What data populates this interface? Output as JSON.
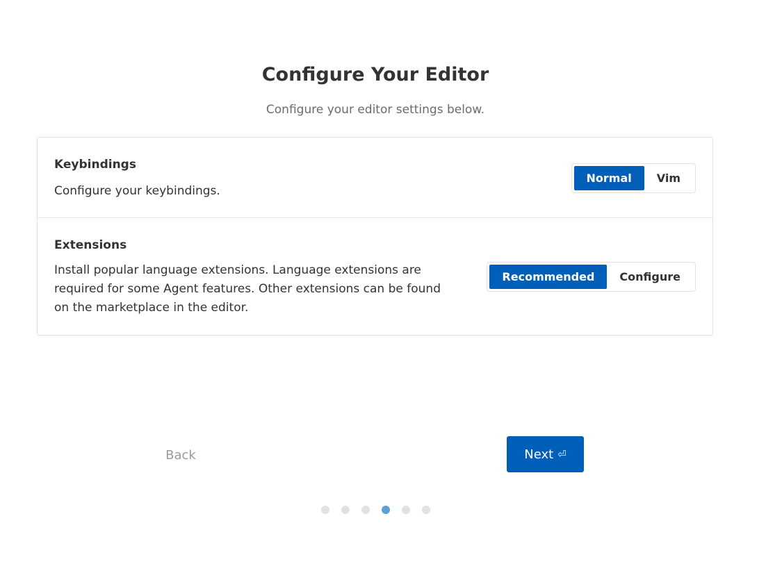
{
  "header": {
    "title": "Configure Your Editor",
    "subtitle": "Configure your editor settings below."
  },
  "settings": {
    "keybindings": {
      "title": "Keybindings",
      "description": "Configure your keybindings.",
      "options": [
        "Normal",
        "Vim"
      ],
      "selected": "Normal"
    },
    "extensions": {
      "title": "Extensions",
      "description": "Install popular language extensions. Language extensions are required for some Agent features. Other extensions can be found on the marketplace in the editor.",
      "options": [
        "Recommended",
        "Configure"
      ],
      "selected": "Recommended"
    }
  },
  "footer": {
    "back_label": "Back",
    "next_label": "Next",
    "next_icon": "⏎",
    "steps_total": 6,
    "current_step": 4
  },
  "colors": {
    "accent": "#005fb8",
    "dot_active": "#5d9fd6",
    "dot_inactive": "#e1e1e1"
  }
}
